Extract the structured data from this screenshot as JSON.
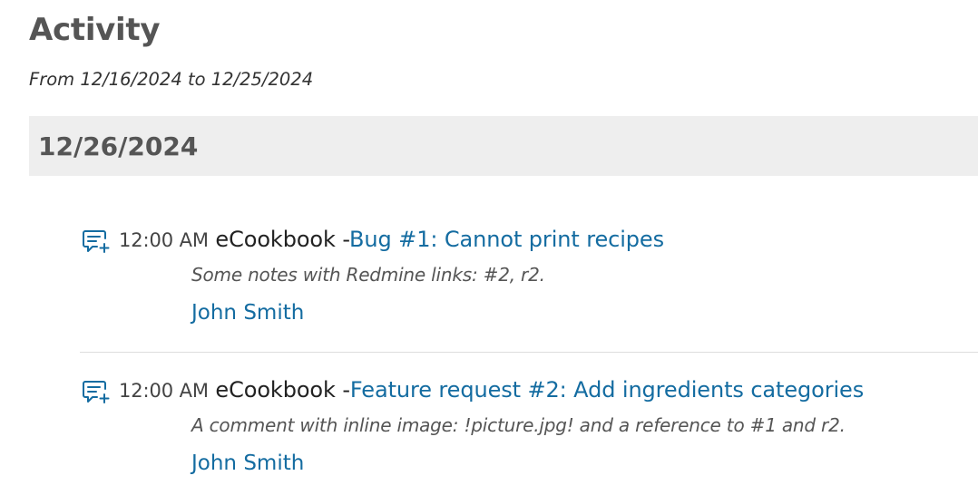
{
  "page": {
    "title": "Activity",
    "subtitle": "From 12/16/2024 to 12/25/2024"
  },
  "day": {
    "date": "12/26/2024"
  },
  "events": [
    {
      "icon": "comment-add-icon",
      "time": "12:00 AM",
      "project": "eCookbook -",
      "link": "Bug #1: Cannot print recipes",
      "description": "Some notes with Redmine links: #2, r2.",
      "author": "John Smith"
    },
    {
      "icon": "comment-add-icon",
      "time": "12:00 AM",
      "project": "eCookbook -",
      "link": "Feature request #2: Add ingredients categories",
      "description": "A comment with inline image: !picture.jpg! and a reference to #1 and r2.",
      "author": "John Smith"
    }
  ],
  "colors": {
    "link": "#146ca1",
    "heading": "#555555",
    "day_header_bg": "#eeeeee",
    "icon": "#146ca1"
  }
}
